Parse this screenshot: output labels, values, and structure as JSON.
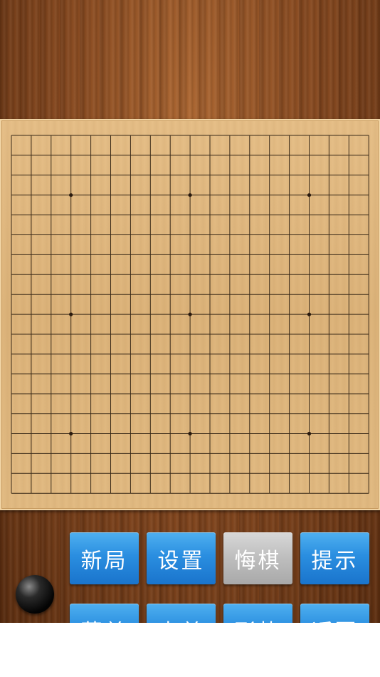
{
  "board": {
    "size": 19,
    "star_points": [
      [
        3,
        3
      ],
      [
        3,
        9
      ],
      [
        3,
        15
      ],
      [
        9,
        3
      ],
      [
        9,
        9
      ],
      [
        9,
        15
      ],
      [
        15,
        3
      ],
      [
        15,
        9
      ],
      [
        15,
        15
      ]
    ]
  },
  "current_turn": {
    "stone_color": "black"
  },
  "buttons": {
    "row1": [
      {
        "label": "新局",
        "enabled": true
      },
      {
        "label": "设置",
        "enabled": true
      },
      {
        "label": "悔棋",
        "enabled": false
      },
      {
        "label": "提示",
        "enabled": true
      }
    ],
    "row2": [
      {
        "label": "菜单",
        "enabled": true
      },
      {
        "label": "点单",
        "enabled": true
      },
      {
        "label": "形势",
        "enabled": true
      },
      {
        "label": "返回",
        "enabled": true
      }
    ]
  },
  "colors": {
    "button_blue": "#2a8ee0",
    "button_disabled": "#bdbdbd",
    "board_wood": "#ddb47b",
    "background_wood": "#8a4c22"
  }
}
